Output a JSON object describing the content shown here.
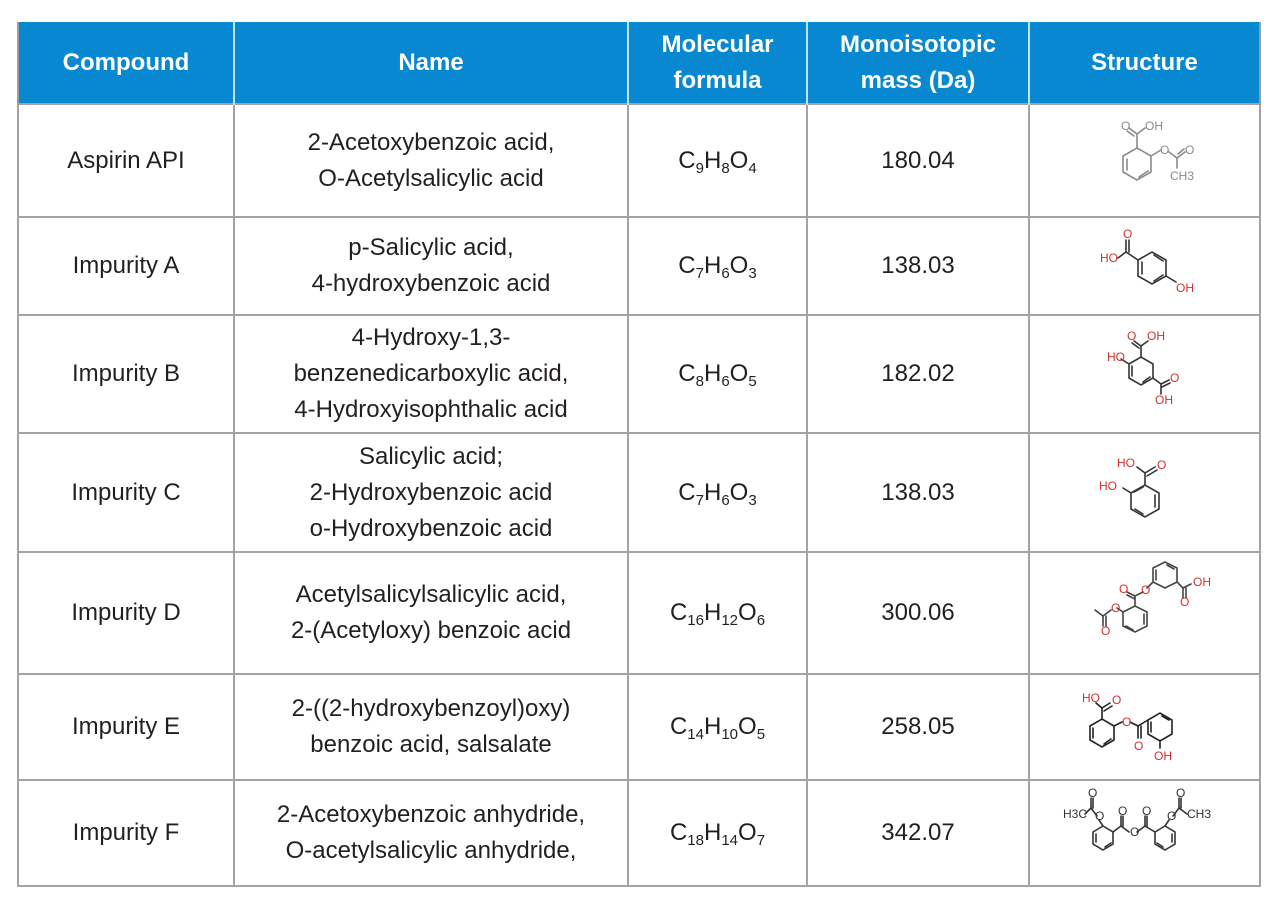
{
  "table": {
    "headers": {
      "compound": "Compound",
      "name": "Name",
      "formula": [
        "Molecular",
        "formula"
      ],
      "mass": [
        "Monoisotopic",
        "mass (Da)"
      ],
      "structure": "Structure"
    },
    "rows": [
      {
        "compound": "Aspirin API",
        "names": [
          "2-Acetoxybenzoic acid,",
          "O-Acetylsalicylic acid"
        ],
        "formula": {
          "C": "9",
          "H": "8",
          "O": "4"
        },
        "mass": "180.04",
        "structure_icon": "aspirin-structure-icon"
      },
      {
        "compound": "Impurity A",
        "names": [
          "p-Salicylic acid,",
          "4-hydroxybenzoic acid"
        ],
        "formula": {
          "C": "7",
          "H": "6",
          "O": "3"
        },
        "mass": "138.03",
        "structure_icon": "4-hydroxybenzoic-acid-structure-icon"
      },
      {
        "compound": "Impurity B",
        "names": [
          "4-Hydroxy-1,3-",
          "benzenedicarboxylic acid,",
          "4-Hydroxyisophthalic acid"
        ],
        "formula": {
          "C": "8",
          "H": "6",
          "O": "5"
        },
        "mass": "182.02",
        "structure_icon": "4-hydroxyisophthalic-acid-structure-icon"
      },
      {
        "compound": "Impurity C",
        "names": [
          "Salicylic acid;",
          "2-Hydroxybenzoic acid",
          "o-Hydroxybenzoic acid"
        ],
        "formula": {
          "C": "7",
          "H": "6",
          "O": "3"
        },
        "mass": "138.03",
        "structure_icon": "salicylic-acid-structure-icon"
      },
      {
        "compound": "Impurity D",
        "names": [
          "Acetylsalicylsalicylic acid,",
          "2-(Acetyloxy) benzoic acid"
        ],
        "formula": {
          "C": "16",
          "H": "12",
          "O": "6"
        },
        "mass": "300.06",
        "structure_icon": "acetylsalicylsalicylic-acid-structure-icon"
      },
      {
        "compound": "Impurity E",
        "names": [
          "2-((2-hydroxybenzoyl)oxy)",
          "benzoic acid, salsalate"
        ],
        "formula": {
          "C": "14",
          "H": "10",
          "O": "5"
        },
        "mass": "258.05",
        "structure_icon": "salsalate-structure-icon"
      },
      {
        "compound": "Impurity F",
        "names": [
          "2-Acetoxybenzoic anhydride,",
          "O-acetylsalicylic anhydride,"
        ],
        "formula": {
          "C": "18",
          "H": "14",
          "O": "7"
        },
        "mass": "342.07",
        "structure_icon": "acetylsalicylic-anhydride-structure-icon"
      }
    ],
    "structure_labels": {
      "oh": "OH",
      "ho": "HO",
      "o": "O",
      "ch3": "CH3",
      "h3c": "H3C"
    }
  },
  "colors": {
    "header_bg": "#0788d0",
    "header_text": "#ffffff",
    "border": "#a3a3a3",
    "text": "#231f20",
    "atom_red": "#d0312d",
    "structure_gray": "#8a8a8a"
  }
}
